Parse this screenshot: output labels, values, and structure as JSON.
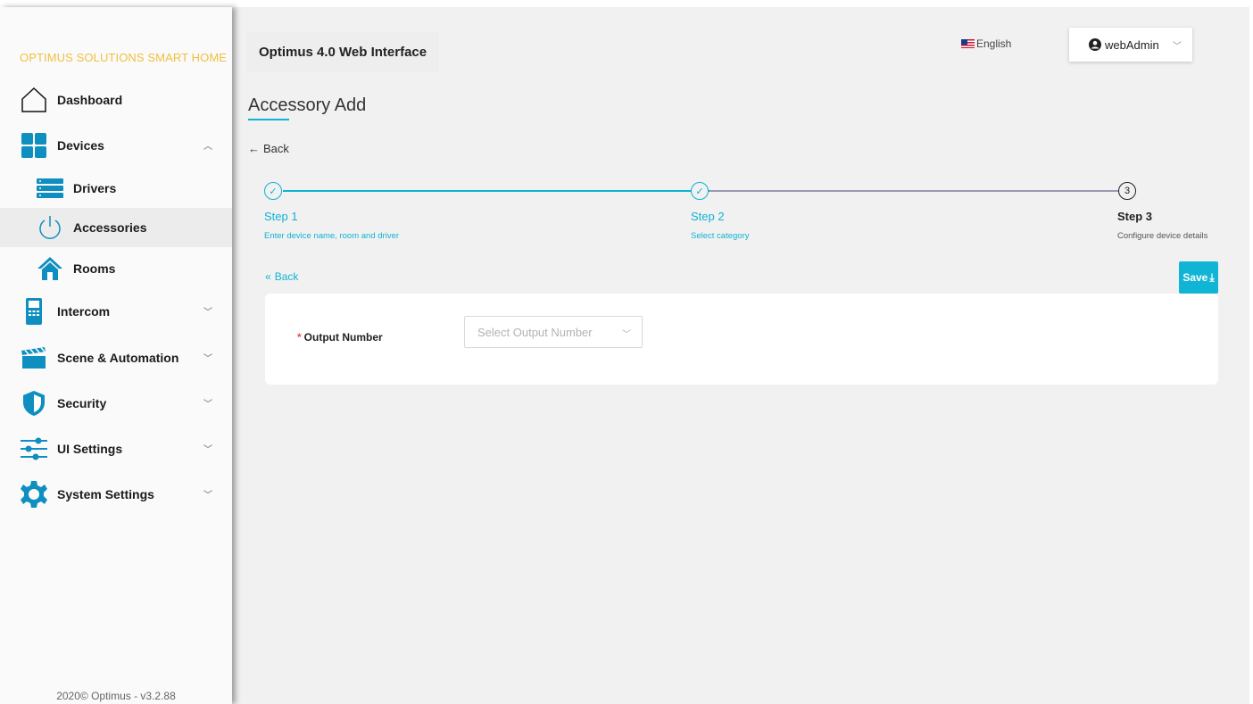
{
  "brand": "OPTIMUS SOLUTIONS SMART HOME",
  "sidebar": {
    "items": [
      {
        "label": "Dashboard"
      },
      {
        "label": "Devices"
      },
      {
        "label": "Drivers"
      },
      {
        "label": "Accessories"
      },
      {
        "label": "Rooms"
      },
      {
        "label": "Intercom"
      },
      {
        "label": "Scene & Automation"
      },
      {
        "label": "Security"
      },
      {
        "label": "UI Settings"
      },
      {
        "label": "System Settings"
      }
    ],
    "active": "Accessories",
    "footer": "2020© Optimus - v3.2.88"
  },
  "header": {
    "app_title": "Optimus 4.0 Web Interface",
    "language": "English",
    "user": "webAdmin"
  },
  "page": {
    "title": "Accessory Add",
    "back_label": "Back",
    "steps": [
      {
        "title": "Step 1",
        "desc": "Enter device name, room and driver",
        "marker": "✓"
      },
      {
        "title": "Step 2",
        "desc": "Select category",
        "marker": "✓"
      },
      {
        "title": "Step 3",
        "desc": "Configure device details",
        "marker": "3"
      }
    ],
    "current_step": 3,
    "step_back_label": "Back",
    "save_label": "Save",
    "form": {
      "output_label": "Output Number",
      "output_placeholder": "Select Output Number"
    }
  },
  "colors": {
    "accent": "#10b5d6",
    "brand": "#f0c040",
    "required": "#e25050"
  }
}
